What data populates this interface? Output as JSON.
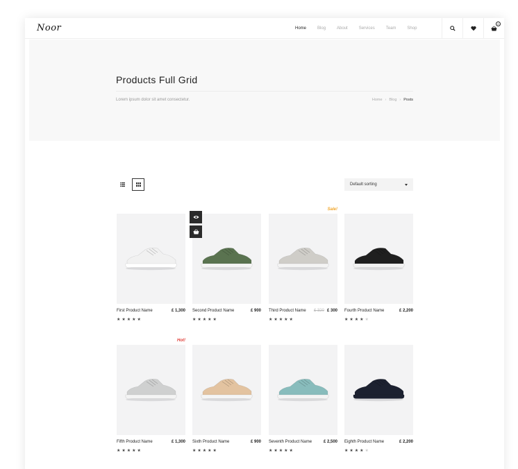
{
  "header": {
    "logo": "Noor",
    "nav": [
      "Home",
      "Blog",
      "About",
      "Services",
      "Team",
      "Shop"
    ],
    "active_nav": "Home",
    "cart_count": "0"
  },
  "hero": {
    "title": "Products Full Grid",
    "subtitle": "Lorem ipsum dolor sit amet consectetur.",
    "breadcrumb": [
      "Home",
      "Blog",
      "Posts"
    ]
  },
  "toolbar": {
    "sort_label": "Default sorting",
    "view_mode": "grid"
  },
  "products": [
    {
      "name": "First Product Name",
      "price": "£ 1,300",
      "old_price": "",
      "rating": 5,
      "tag": "",
      "shoe_color": "#f1f1f1",
      "sole_color": "#ffffff"
    },
    {
      "name": "Second Product Name",
      "price": "£ 900",
      "old_price": "",
      "rating": 5,
      "tag": "",
      "shoe_color": "#5a7350",
      "sole_color": "#f5f5f5"
    },
    {
      "name": "Third Product Name",
      "price": "£ 300",
      "old_price": "£ 320",
      "rating": 5,
      "tag": "Sale!",
      "shoe_color": "#cfcdc8",
      "sole_color": "#f4f4f4"
    },
    {
      "name": "Fourth Product Name",
      "price": "£ 2,200",
      "old_price": "",
      "rating": 4,
      "tag": "",
      "shoe_color": "#1f1f1f",
      "sole_color": "#f2f2f2"
    },
    {
      "name": "Fifth  Product Name",
      "price": "£ 1,300",
      "old_price": "",
      "rating": 5,
      "tag": "Hot!",
      "shoe_color": "#cfd0d0",
      "sole_color": "#f4f4f4"
    },
    {
      "name": "Sixth Product Name",
      "price": "£ 900",
      "old_price": "",
      "rating": 5,
      "tag": "",
      "shoe_color": "#e3c3a0",
      "sole_color": "#f5f5f5"
    },
    {
      "name": "Seventh Product Name",
      "price": "£ 2,500",
      "old_price": "",
      "rating": 5,
      "tag": "",
      "shoe_color": "#88bcbc",
      "sole_color": "#f4f4f4"
    },
    {
      "name": "Eighth Product Name",
      "price": "£ 2,200",
      "old_price": "",
      "rating": 4,
      "tag": "",
      "shoe_color": "#1c2130",
      "sole_color": "#1c2130"
    }
  ],
  "colors": {
    "sale_tag": "#f0a52a",
    "hot_tag": "#e0403a",
    "quick_action_bg": "#2b2b2b"
  }
}
